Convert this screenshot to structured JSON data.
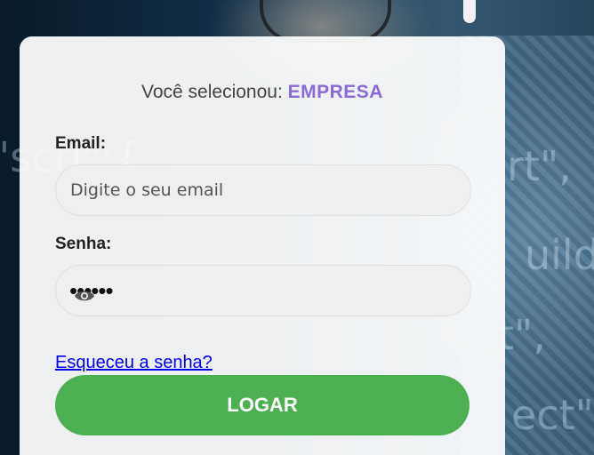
{
  "selection": {
    "prefix": "Você selecionou: ",
    "type": "EMPRESA"
  },
  "email": {
    "label": "Email:",
    "placeholder": "Digite o seu email",
    "value": ""
  },
  "password": {
    "label": "Senha:",
    "masked_value": "••••••",
    "toggle_icon": "eye-icon"
  },
  "forgot_link": "Esqueceu a senha?",
  "login_button": "LOGAR",
  "colors": {
    "accent": "#8a6ad6",
    "button": "#4caf50",
    "link": "#0000ee"
  }
}
